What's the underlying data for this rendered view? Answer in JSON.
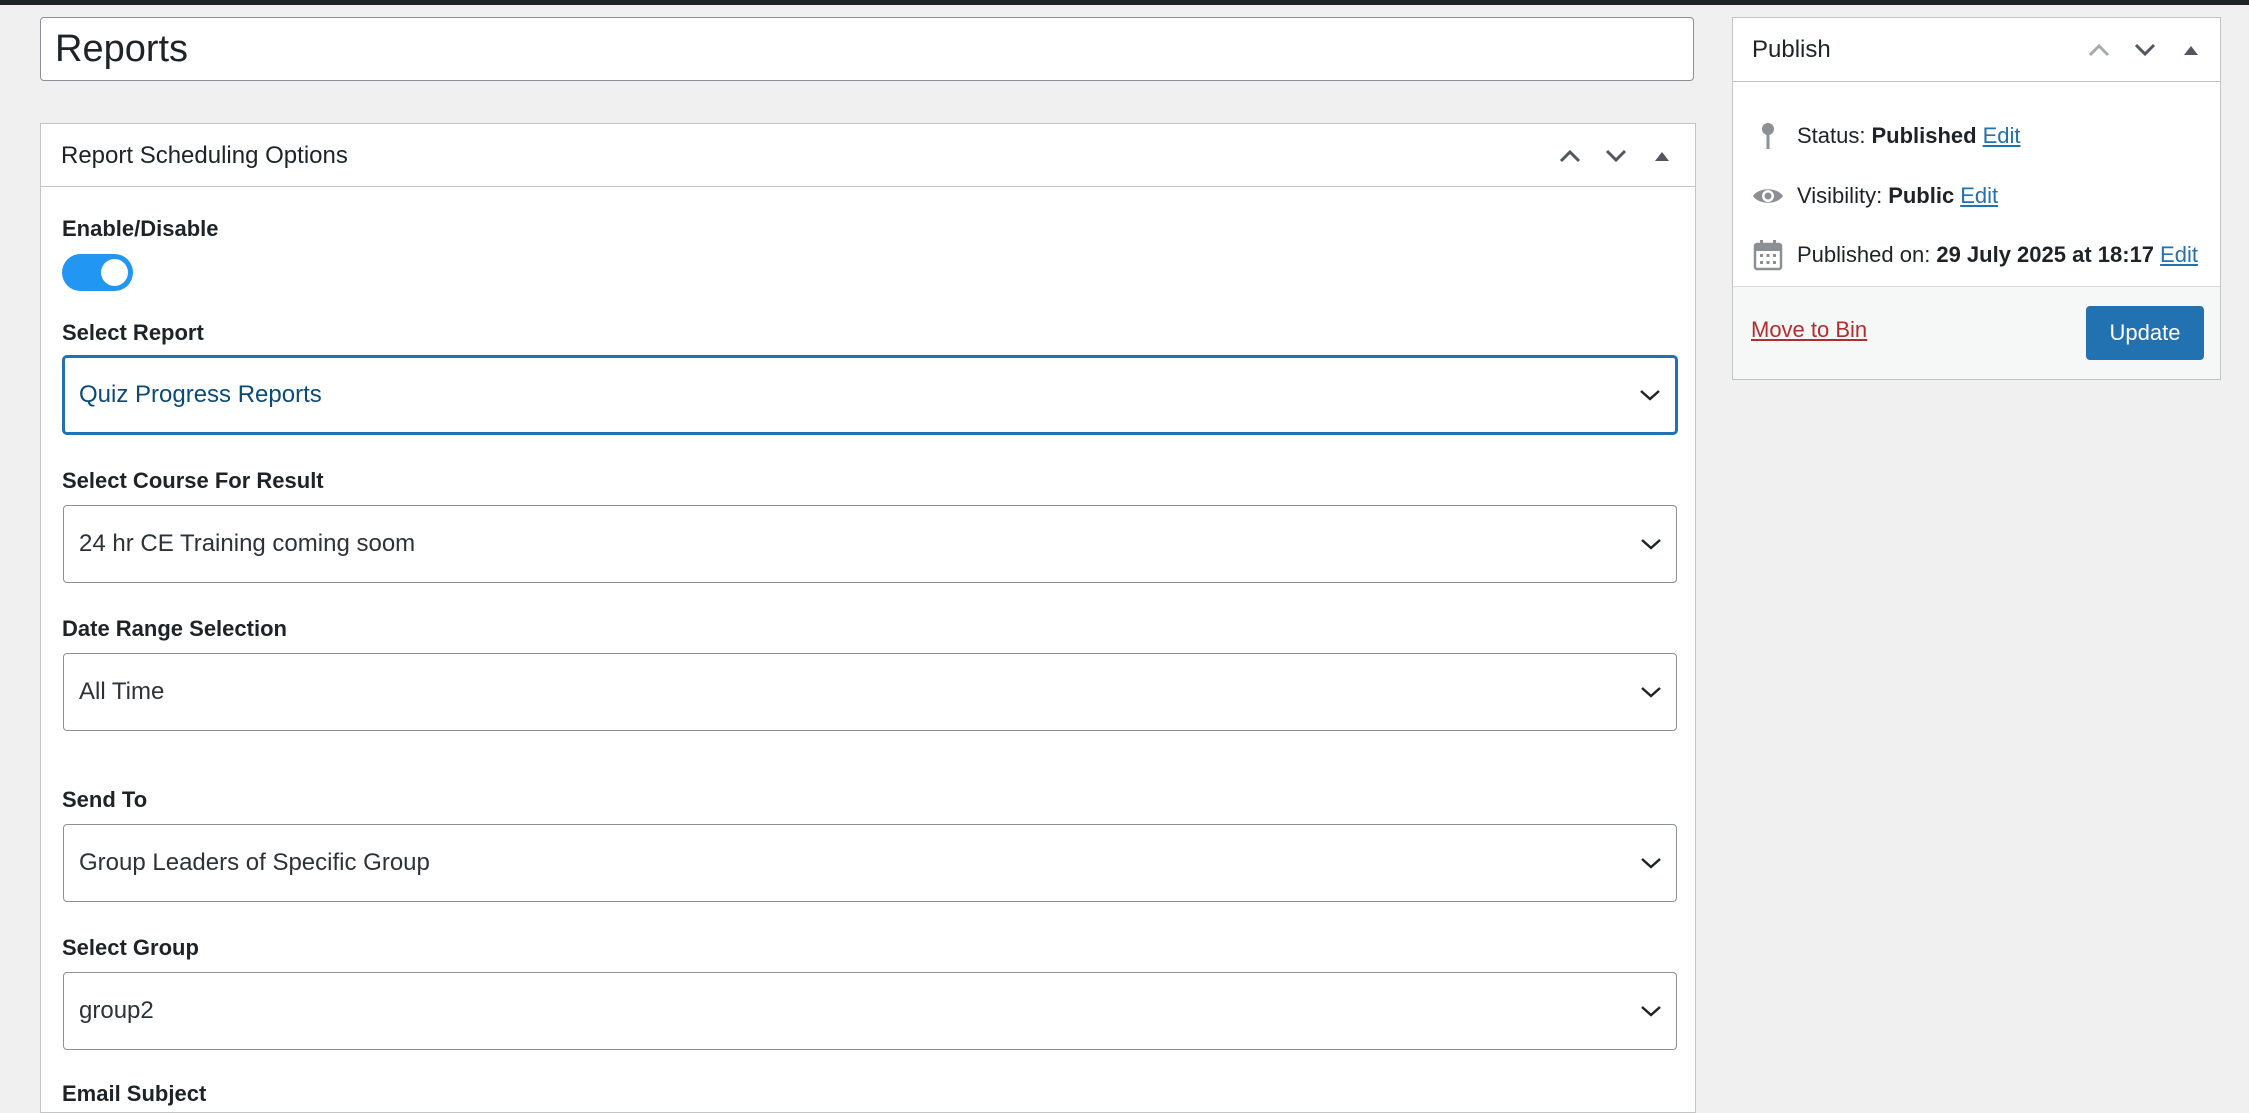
{
  "title": {
    "value": "Reports"
  },
  "scheduling_box": {
    "title": "Report Scheduling Options",
    "enable_label": "Enable/Disable",
    "enabled": true,
    "fields": [
      {
        "label": "Select Report",
        "value": "Quiz Progress Reports"
      },
      {
        "label": "Select Course For Result",
        "value": "24 hr CE Training coming soom"
      },
      {
        "label": "Date Range Selection",
        "value": "All Time"
      },
      {
        "label": "Send To",
        "value": "Group Leaders of Specific Group"
      },
      {
        "label": "Select Group",
        "value": "group2"
      }
    ],
    "next_label": "Email Subject"
  },
  "publish_box": {
    "title": "Publish",
    "status_label": "Status:",
    "status_value": "Published",
    "visibility_label": "Visibility:",
    "visibility_value": "Public",
    "published_label": "Published on:",
    "published_value": "29 July 2025 at 18:17",
    "edit_label": "Edit",
    "move_to_bin": "Move to Bin",
    "update": "Update"
  },
  "icons": {
    "move_up": "chevron-up-icon",
    "move_down": "chevron-down-icon",
    "toggle_panel": "triangle-up-icon",
    "status": "pin-icon",
    "visibility": "eye-icon",
    "published": "calendar-icon",
    "select": "chevron-down-icon"
  },
  "colors": {
    "accent": "#2271b1",
    "toggle_on": "#2196f3",
    "danger": "#b32d2e"
  }
}
